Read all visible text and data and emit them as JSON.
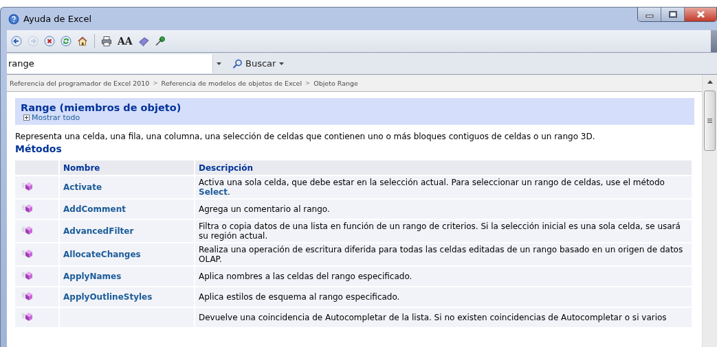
{
  "window": {
    "title": "Ayuda de Excel"
  },
  "toolbar": [
    {
      "kind": "back",
      "disabled": false
    },
    {
      "kind": "forward",
      "disabled": true
    },
    {
      "kind": "stop",
      "disabled": false
    },
    {
      "kind": "refresh",
      "disabled": false
    },
    {
      "kind": "home",
      "disabled": false
    },
    {
      "kind": "separator"
    },
    {
      "kind": "print",
      "disabled": false
    },
    {
      "kind": "textsize",
      "glyph": "AA",
      "disabled": false
    },
    {
      "kind": "book",
      "disabled": false
    },
    {
      "kind": "pin",
      "disabled": false
    }
  ],
  "search": {
    "value": "range",
    "button": "Buscar"
  },
  "breadcrumb": [
    {
      "kind": "link",
      "text": "Referencia del programador de Excel 2010"
    },
    {
      "kind": "sep",
      "text": ">"
    },
    {
      "kind": "link",
      "text": "Referencia de modelos de objetos de Excel"
    },
    {
      "kind": "sep",
      "text": ">"
    },
    {
      "kind": "link",
      "text": "Objeto Range"
    }
  ],
  "page": {
    "title": "Range (miembros de objeto)",
    "expand_all": "Mostrar todo",
    "description": "Representa una celda, una fila, una columna, una selección de celdas que contienen uno o más bloques contiguos de celdas o un rango 3D.",
    "section": "Métodos",
    "table": {
      "columns": [
        "Nombre",
        "Descripción"
      ],
      "rows": [
        {
          "name": "Activate",
          "description": "Activa una sola celda, que debe estar en la selección actual. Para seleccionar un rango de celdas, use el método **Select**."
        },
        {
          "name": "AddComment",
          "description": "Agrega un comentario al rango."
        },
        {
          "name": "AdvancedFilter",
          "description": "Filtra o copia datos de una lista en función de un rango de criterios. Si la selección inicial es una sola celda, se usará su región actual."
        },
        {
          "name": "AllocateChanges",
          "description": "Realiza una operación de escritura diferida para todas las celdas editadas de un rango basado en un origen de datos OLAP."
        },
        {
          "name": "ApplyNames",
          "description": "Aplica nombres a las celdas del rango especificado."
        },
        {
          "name": "ApplyOutlineStyles",
          "description": "Aplica estilos de esquema al rango especificado."
        },
        {
          "description": "Devuelve una coincidencia de Autocompletar de la lista. Si no existen coincidencias de Autocompletar o si varios"
        }
      ]
    }
  }
}
